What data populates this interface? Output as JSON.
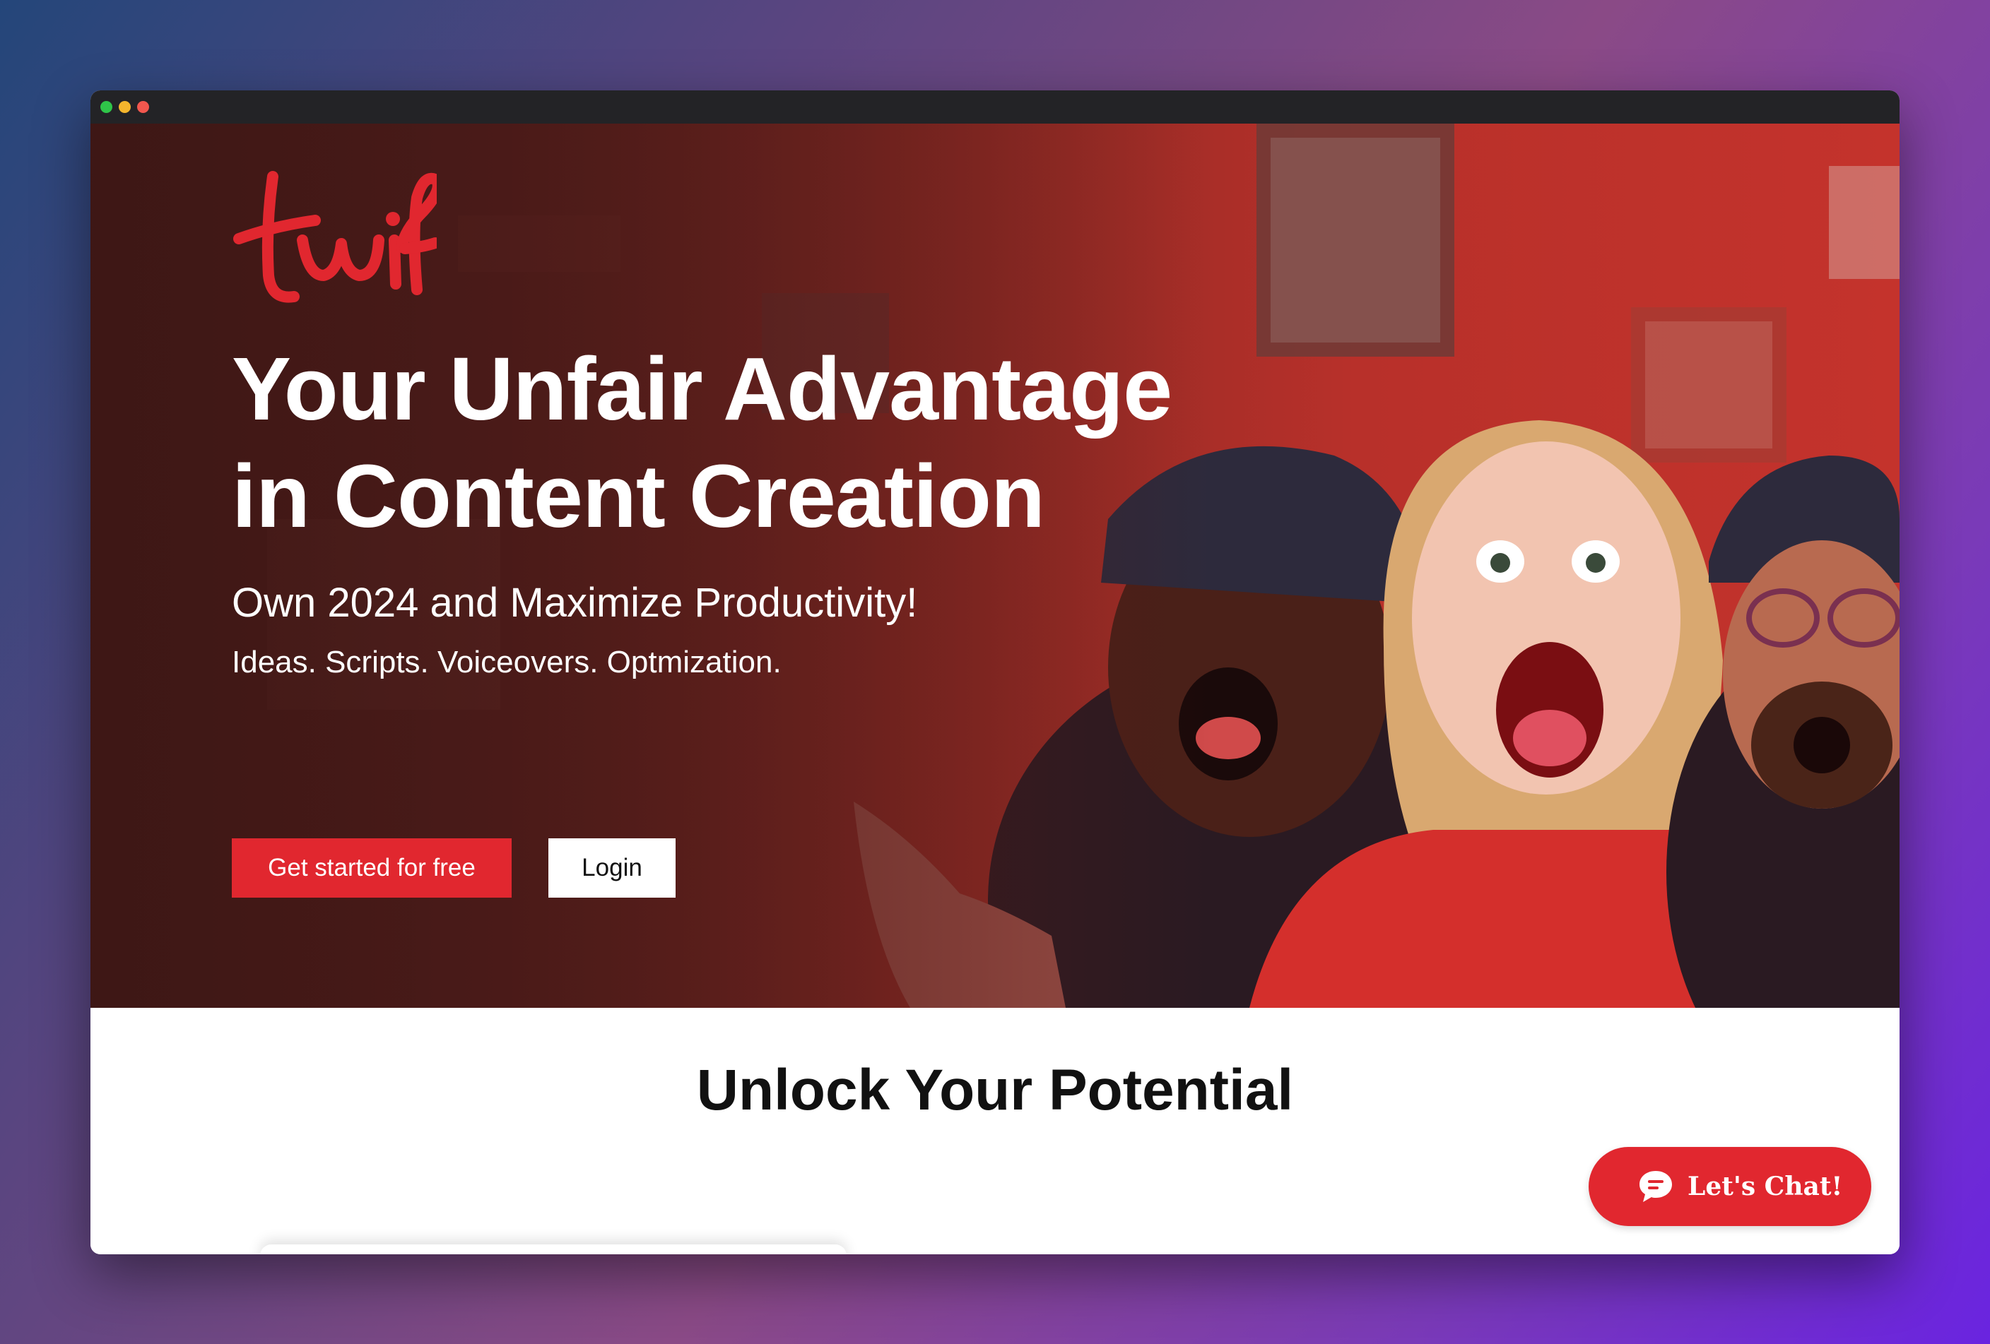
{
  "window": {
    "controls": [
      "close",
      "minimize",
      "maximize"
    ]
  },
  "brand": {
    "logo_text": "twif",
    "accent_color": "#e1272f"
  },
  "hero": {
    "headline_line1": "Your Unfair Advantage",
    "headline_line2": "in Content Creation",
    "subheadline": "Own 2024 and Maximize Productivity!",
    "tagline": "Ideas. Scripts. Voiceovers. Optmization.",
    "primary_cta": "Get started for free",
    "secondary_cta": "Login",
    "image_description_icon": "illustration-excited-people-icon"
  },
  "section": {
    "title": "Unlock Your Potential"
  },
  "chat": {
    "label": "Let's Chat!",
    "icon": "chat-bubble-icon"
  }
}
